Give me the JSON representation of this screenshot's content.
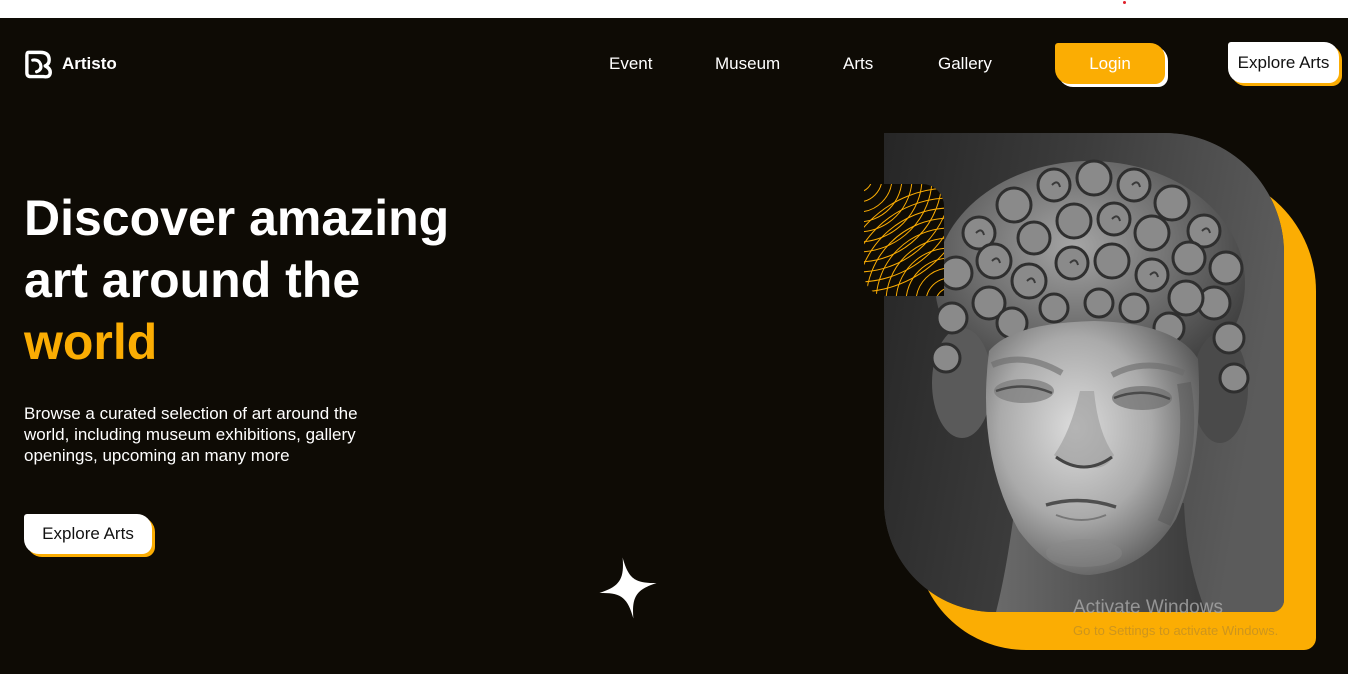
{
  "brand": {
    "name": "Artisto",
    "logo_icon": "artisto-logo-icon"
  },
  "nav": {
    "items": [
      {
        "label": "Event"
      },
      {
        "label": "Museum"
      },
      {
        "label": "Arts"
      },
      {
        "label": "Gallery"
      }
    ],
    "login_label": "Login",
    "explore_label": "Explore Arts"
  },
  "hero": {
    "title_line1": "Discover amazing",
    "title_line2": "art around the",
    "title_highlight": "world",
    "description": "Browse a curated selection of art around the world, including museum exhibitions, gallery openings, upcoming an many more",
    "cta_label": "Explore Arts"
  },
  "decor": {
    "sparkle_icon": "sparkle-icon"
  },
  "os_watermark": {
    "title": "Activate Windows",
    "subtitle": "Go to Settings to activate Windows."
  },
  "colors": {
    "background": "#0e0b05",
    "accent": "#fbad03",
    "text": "#ffffff",
    "top_bar": "#ffffff"
  }
}
